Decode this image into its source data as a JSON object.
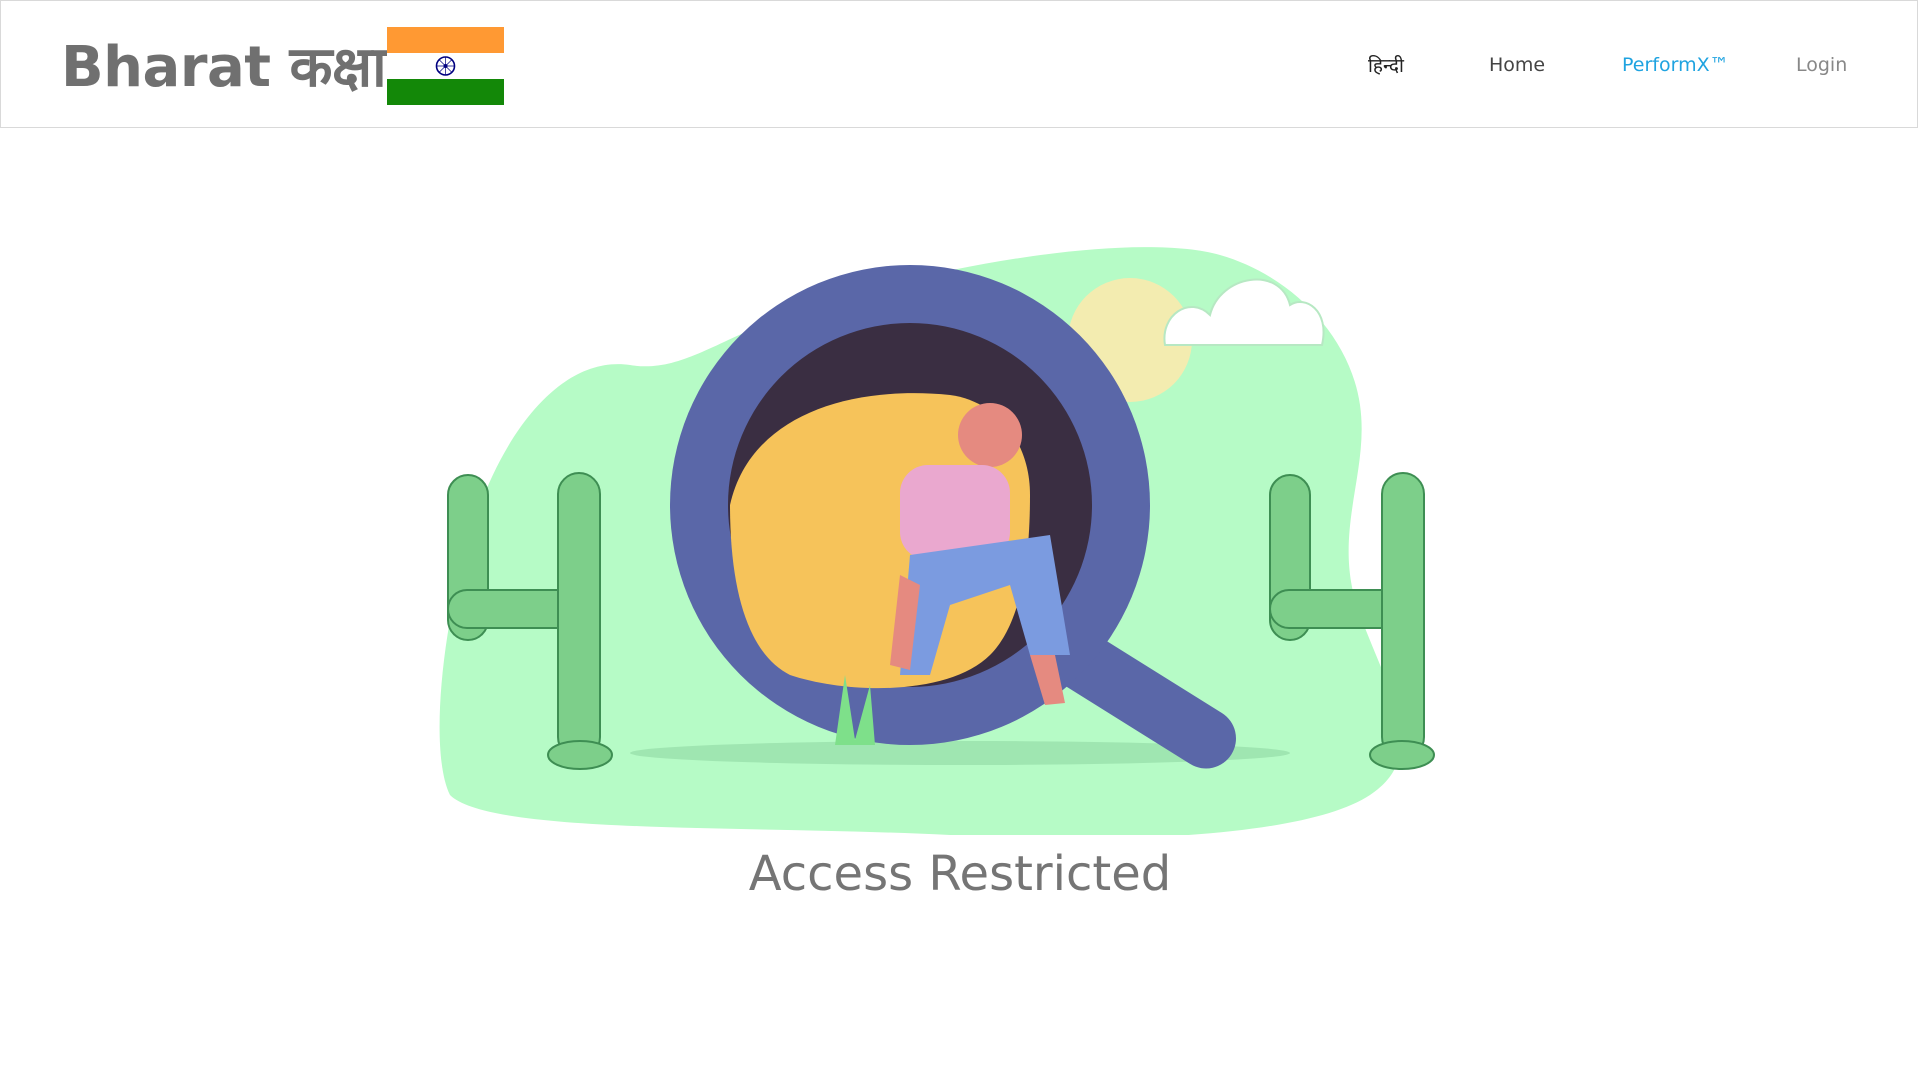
{
  "header": {
    "brand": "Bharat कक्षा",
    "flag_colors": {
      "saffron": "#FF9933",
      "white": "#FFFFFF",
      "green": "#138808",
      "chakra": "#000080"
    },
    "nav": [
      {
        "label": "हिन्दी",
        "color": "#222222"
      },
      {
        "label": "Home",
        "color": "#444444"
      },
      {
        "label": "PerformX™",
        "color": "#1FA3E0"
      },
      {
        "label": "Login",
        "color": "#888888"
      }
    ]
  },
  "main": {
    "illustration": "404-magnifier-girl-cactus",
    "message": "Access Restricted"
  }
}
